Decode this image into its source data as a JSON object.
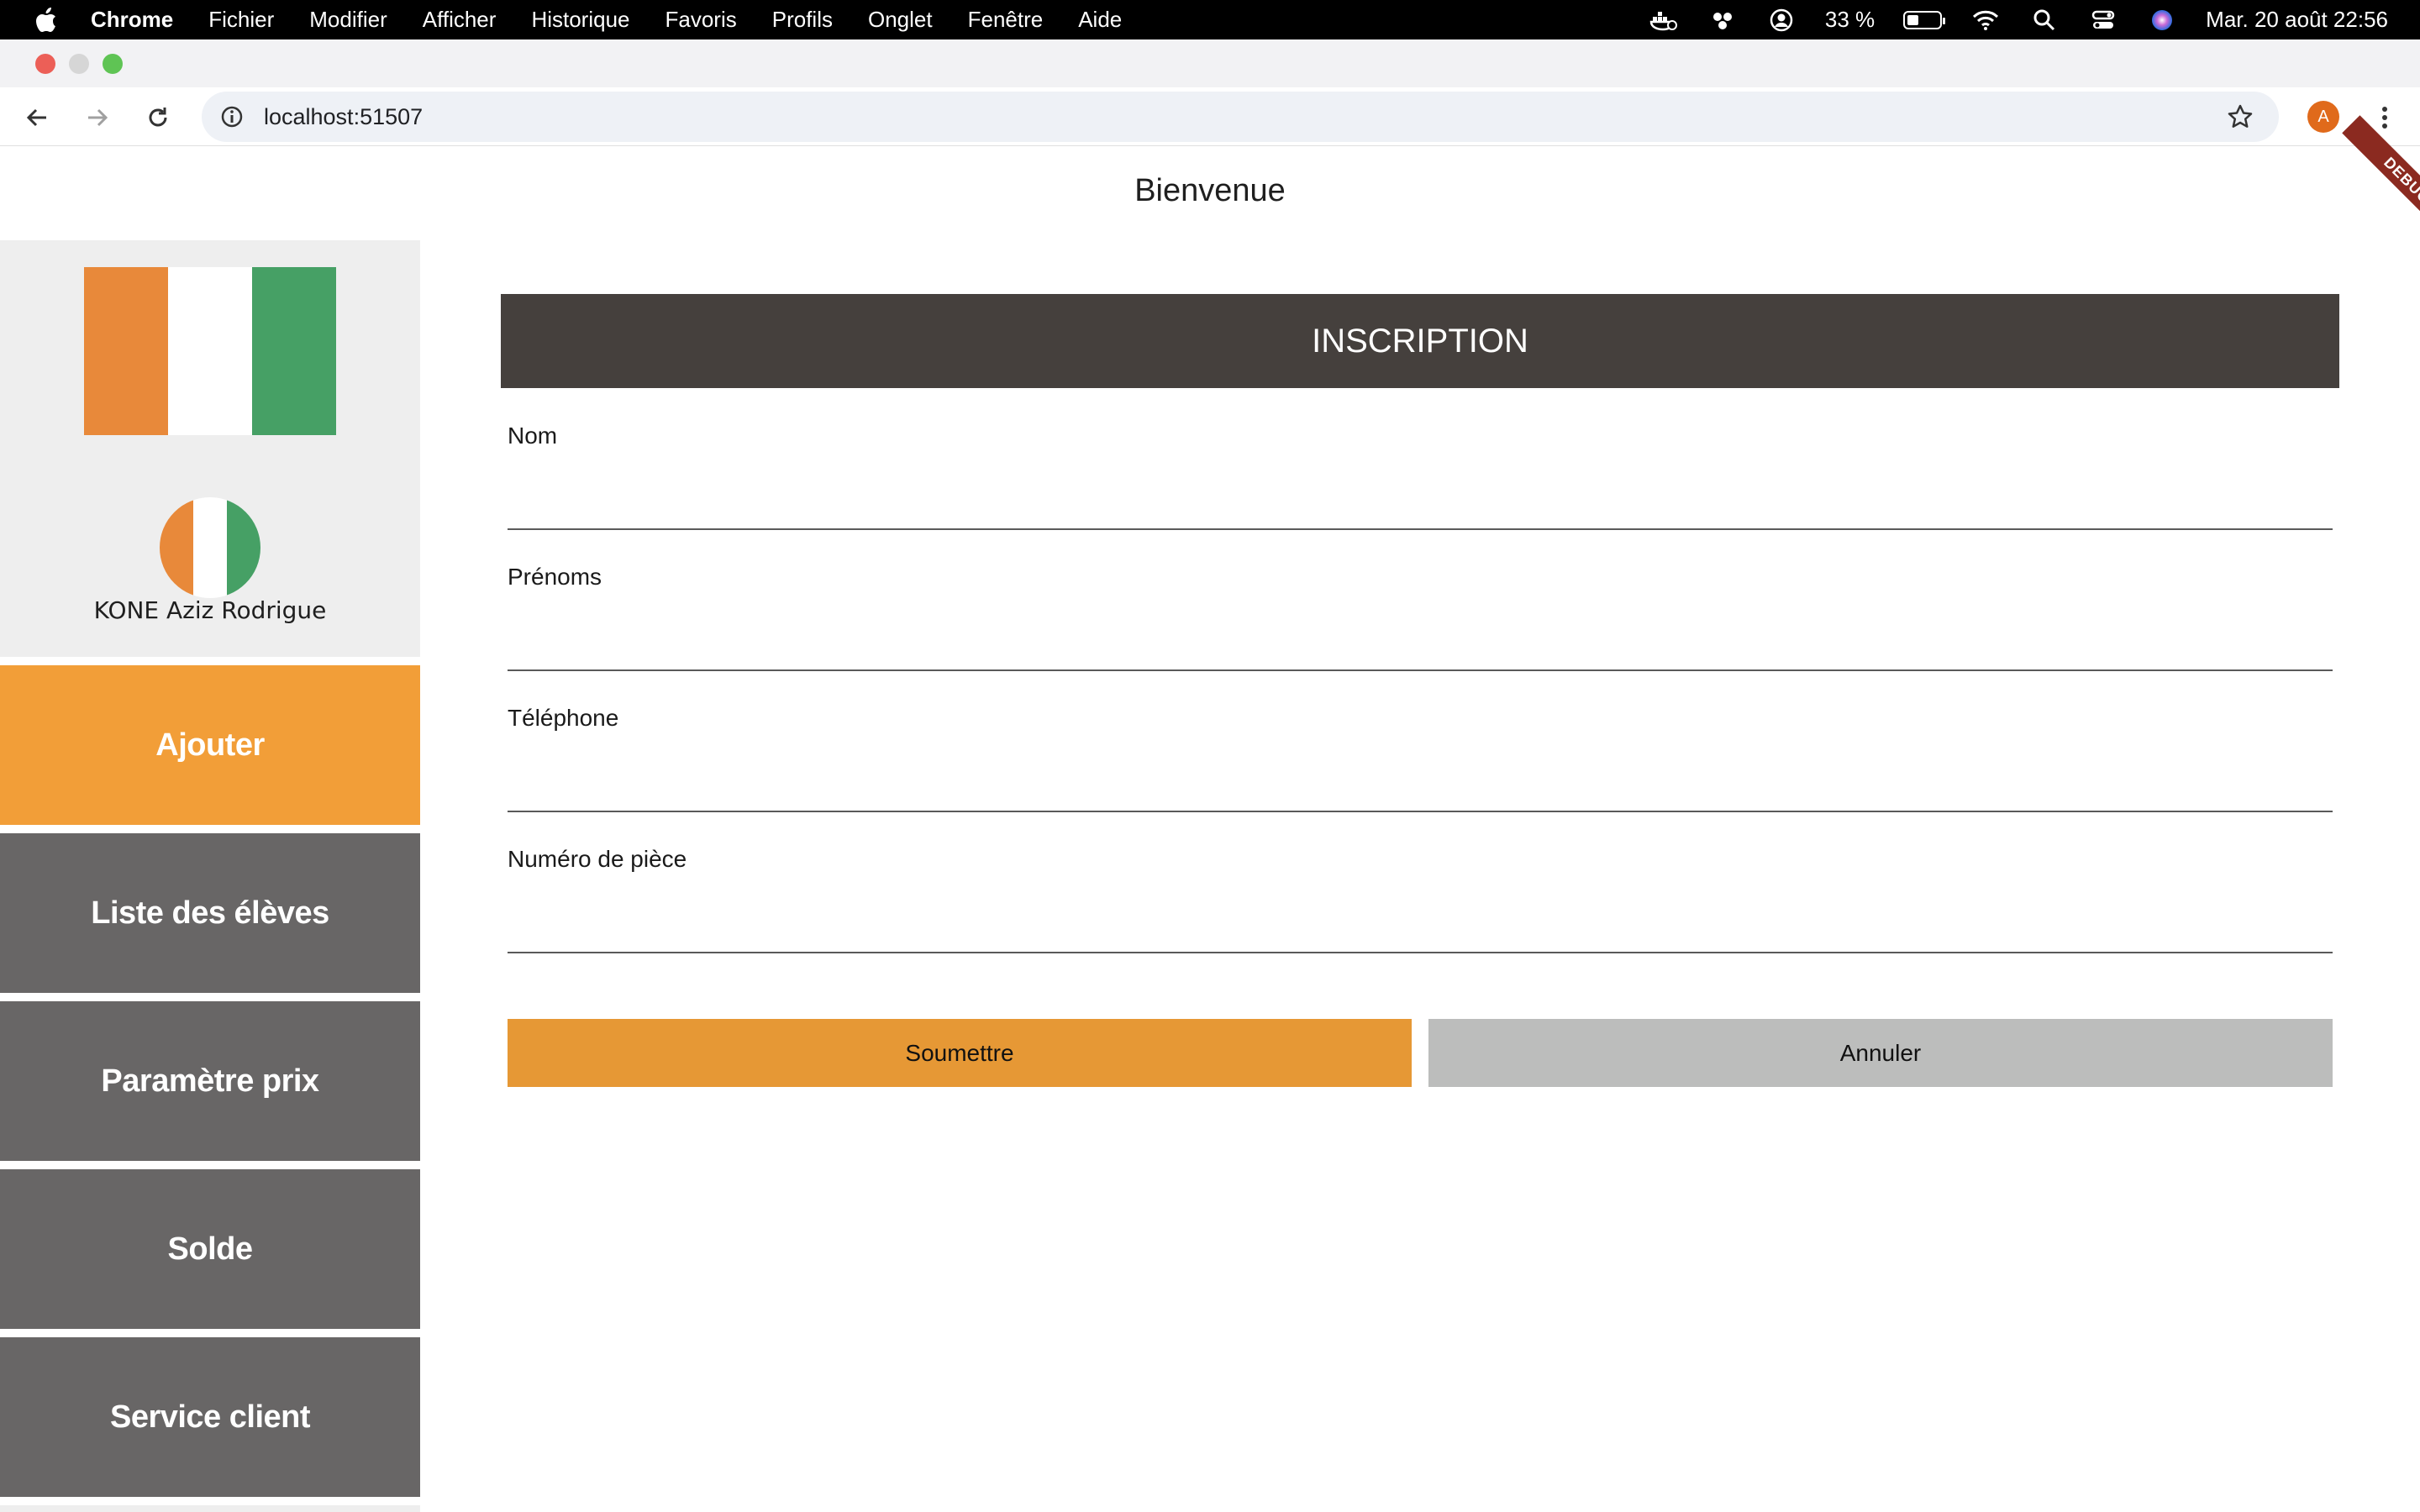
{
  "menubar": {
    "app_name": "Chrome",
    "items": [
      "Fichier",
      "Modifier",
      "Afficher",
      "Historique",
      "Favoris",
      "Profils",
      "Onglet",
      "Fenêtre",
      "Aide"
    ],
    "battery_text": "33 %",
    "battery_level_percent": 33,
    "datetime": "Mar. 20 août  22:56"
  },
  "browser": {
    "url": "localhost:51507",
    "profile_initial": "A"
  },
  "page": {
    "title": "Bienvenue",
    "debug_banner": "DEBUG"
  },
  "sidebar": {
    "user_name": "KONE Aziz Rodrigue",
    "flag_colors": [
      "#e8893a",
      "#ffffff",
      "#46a065"
    ],
    "items": [
      {
        "label": "Ajouter",
        "active": true
      },
      {
        "label": "Liste des élèves",
        "active": false
      },
      {
        "label": "Paramètre prix",
        "active": false
      },
      {
        "label": "Solde",
        "active": false
      },
      {
        "label": "Service client",
        "active": false
      }
    ]
  },
  "form": {
    "header": "INSCRIPTION",
    "fields": [
      {
        "label": "Nom",
        "value": ""
      },
      {
        "label": "Prénoms",
        "value": ""
      },
      {
        "label": "Téléphone",
        "value": ""
      },
      {
        "label": "Numéro de pièce",
        "value": ""
      }
    ],
    "submit_label": "Soumettre",
    "cancel_label": "Annuler"
  },
  "colors": {
    "accent": "#f29e38",
    "submit": "#e69835",
    "cancel": "#bcbdbc",
    "nav_tile": "#686666",
    "header": "#45403d"
  }
}
